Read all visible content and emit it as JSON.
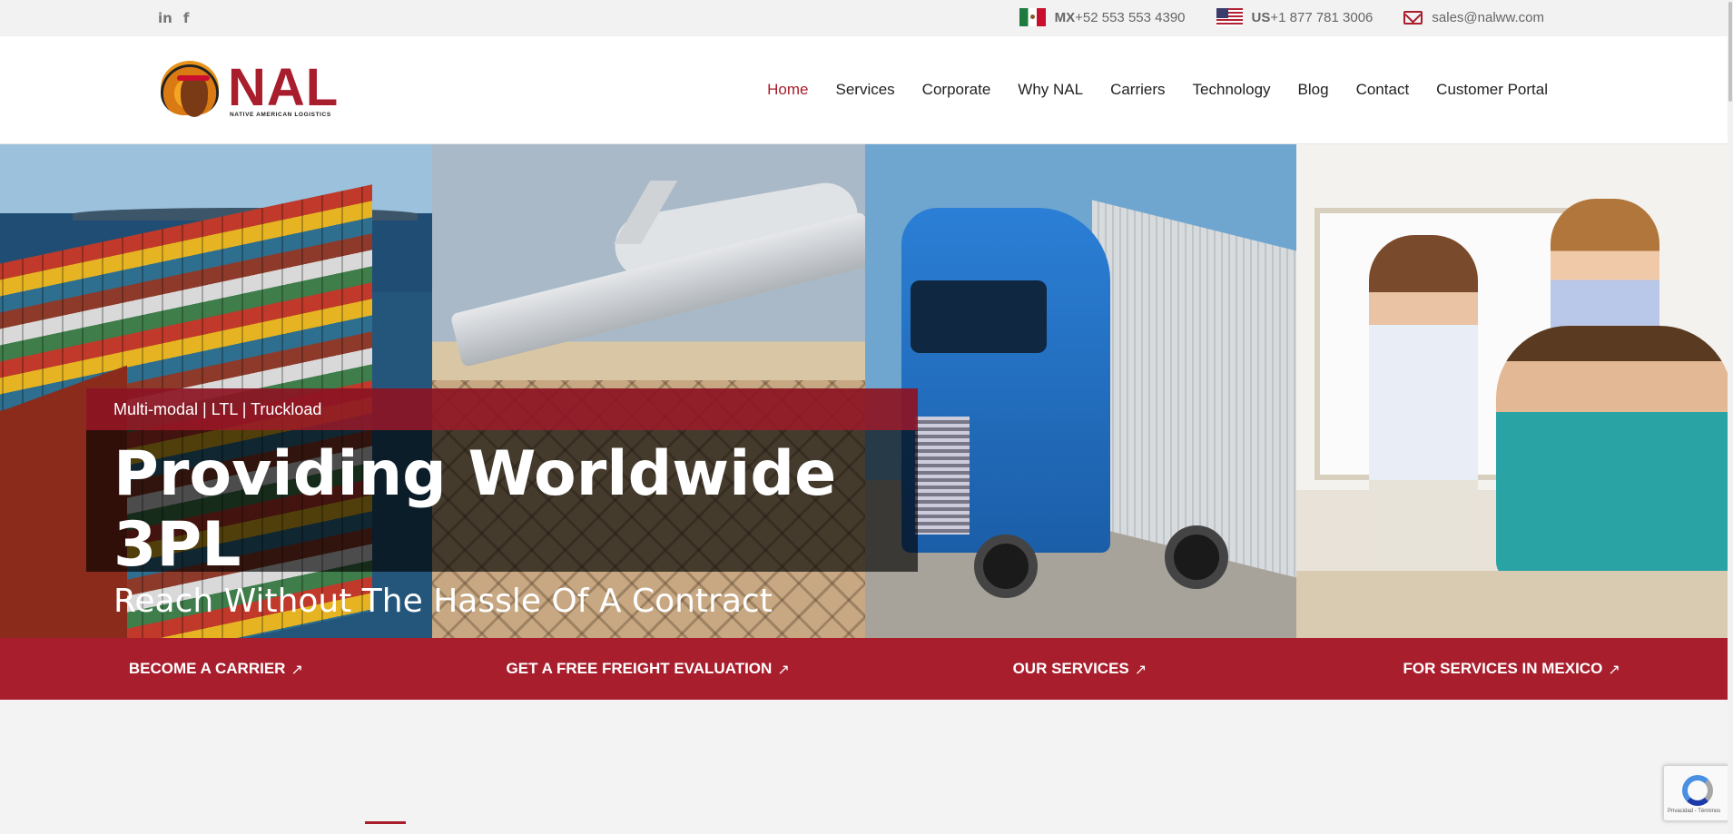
{
  "topbar": {
    "social": [
      {
        "name": "linkedin-icon",
        "glyph": "in"
      },
      {
        "name": "facebook-icon",
        "glyph": "f"
      }
    ],
    "mx": {
      "code": "MX",
      "phone": "+52 553 553 4390"
    },
    "us": {
      "code": "US",
      "phone": "+1 877 781 3006"
    },
    "email": "sales@nalww.com"
  },
  "logo": {
    "text": "NAL",
    "subtitle": "NATIVE AMERICAN LOGISTICS"
  },
  "nav": {
    "items": [
      {
        "label": "Home",
        "active": true
      },
      {
        "label": "Services"
      },
      {
        "label": "Corporate"
      },
      {
        "label": "Why NAL"
      },
      {
        "label": "Carriers"
      },
      {
        "label": "Technology"
      },
      {
        "label": "Blog"
      },
      {
        "label": "Contact"
      },
      {
        "label": "Customer Portal"
      }
    ]
  },
  "hero": {
    "tag": "Multi-modal | LTL | Truckload",
    "title": "Providing Worldwide 3PL",
    "subtitle": "Reach Without The Hassle Of A Contract"
  },
  "cta": [
    {
      "label": "BECOME A CARRIER",
      "arrow": "↗"
    },
    {
      "label": "GET A FREE FREIGHT EVALUATION",
      "arrow": "↗"
    },
    {
      "label": "OUR SERVICES",
      "arrow": "↗"
    },
    {
      "label": "FOR SERVICES IN MEXICO",
      "arrow": "↗"
    }
  ],
  "recaptcha": {
    "terms": "Privacidad - Términos"
  },
  "colors": {
    "brand": "#a81e2d",
    "topbar": "#f2f2f2"
  }
}
